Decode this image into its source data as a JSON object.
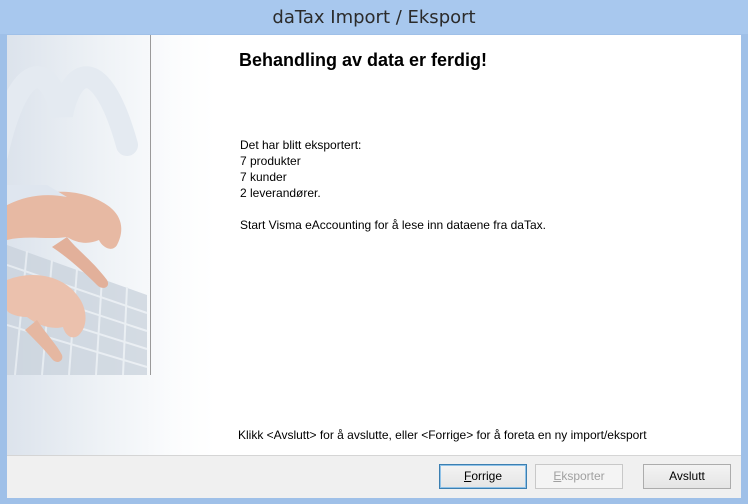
{
  "window": {
    "title": "daTax Import / Eksport"
  },
  "page": {
    "heading": "Behandling av data er ferdig!",
    "lines": [
      "Det har blitt eksportert:",
      "7 produkter",
      "7 kunder",
      "2 leverandører."
    ],
    "instruction": "Start Visma eAccounting for å lese inn dataene fra daTax.",
    "hint": "Klikk <Avslutt> for å avslutte, eller <Forrige> for å foreta en ny import/eksport"
  },
  "buttons": {
    "back": {
      "label_first": "F",
      "label_rest": "orrige"
    },
    "export": {
      "label_first": "E",
      "label_rest": "ksporter",
      "enabled": false
    },
    "finish": {
      "label": "Avslutt"
    }
  },
  "colors": {
    "title_bar": "#a8c8ee",
    "focus_border": "#3c7fb1",
    "disabled_text": "#a0a0a0"
  }
}
